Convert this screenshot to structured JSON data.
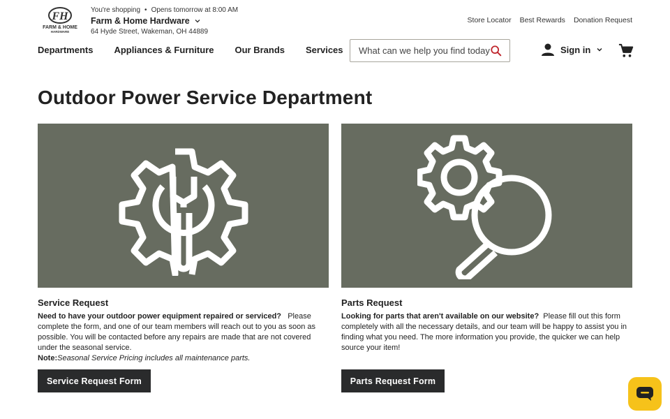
{
  "header": {
    "logo_text": "FARM & HOME HARDWARE",
    "shopping_label": "You're shopping",
    "hours": "Opens tomorrow at 8:00 AM",
    "store_name": "Farm & Home Hardware",
    "address": "64 Hyde Street, Wakeman, OH 44889",
    "util_links": [
      "Store Locator",
      "Best Rewards",
      "Donation Request"
    ]
  },
  "nav": {
    "items": [
      "Departments",
      "Appliances & Furniture",
      "Our Brands",
      "Services"
    ],
    "search_placeholder": "What can we help you find today?",
    "sign_in": "Sign in"
  },
  "main": {
    "title": "Outdoor Power Service Department",
    "cards": [
      {
        "heading": "Service Request",
        "lead": "Need to have your outdoor power equipment repaired or serviced?",
        "body": "Please complete the form, and one of our team members will reach out to you as soon as possible. You will be contacted before any repairs are made that are not covered under the seasonal service.",
        "note_label": "Note:",
        "note_text": "Seasonal Service Pricing includes all maintenance parts.",
        "button": "Service Request Form"
      },
      {
        "heading": "Parts Request",
        "lead": "Looking for parts that aren't available on our website?",
        "body": "Please fill out this form completely with all the necessary details, and our team will be happy to assist you in finding what you need.  The more information you provide, the quicker we can help source your item!",
        "button": "Parts Request Form"
      }
    ]
  },
  "icons": {
    "logo": "farm-home-logo-icon",
    "search": "search-icon",
    "account": "user-icon",
    "cart": "cart-icon",
    "chat": "chat-icon",
    "card1": "gear-wrench-icon",
    "card2": "gear-magnifier-icon"
  },
  "colors": {
    "image_bg": "#676c60",
    "button_bg": "#2a2b2c",
    "chat_bg": "#f6c21a",
    "search_icon": "#c0262d"
  }
}
